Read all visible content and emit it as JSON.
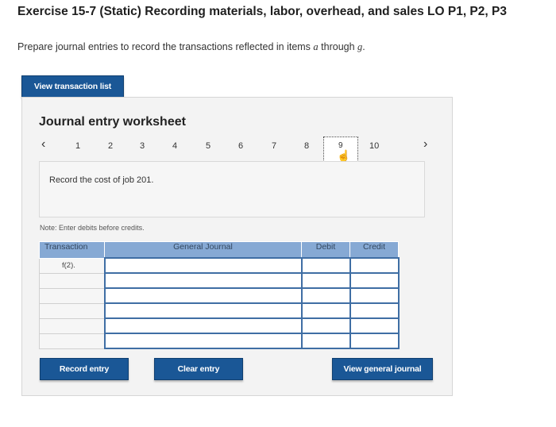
{
  "header": {
    "title": "Exercise 15-7 (Static) Recording materials, labor, overhead, and sales LO P1, P2, P3",
    "prompt_text": "Prepare journal entries to record the transactions reflected in items",
    "prompt_a": "a",
    "prompt_through": "through",
    "prompt_g": "g"
  },
  "buttons": {
    "view_transaction_list": "View transaction list",
    "record_entry": "Record entry",
    "clear_entry": "Clear entry",
    "view_general_journal": "View general journal"
  },
  "worksheet": {
    "title": "Journal entry worksheet",
    "pages": [
      "1",
      "2",
      "3",
      "4",
      "5",
      "6",
      "7",
      "8",
      "9",
      "10"
    ],
    "active_page": "9",
    "description": "Record the cost of job 201.",
    "note": "Note: Enter debits before credits."
  },
  "table": {
    "headers": {
      "transaction": "Transaction",
      "general_journal": "General Journal",
      "debit": "Debit",
      "credit": "Credit"
    },
    "first_transaction": "f(2).",
    "rows": 6
  },
  "icons": {
    "prev": "chevron-left-icon",
    "next": "chevron-right-icon",
    "cursor": "hand-pointer-icon"
  }
}
